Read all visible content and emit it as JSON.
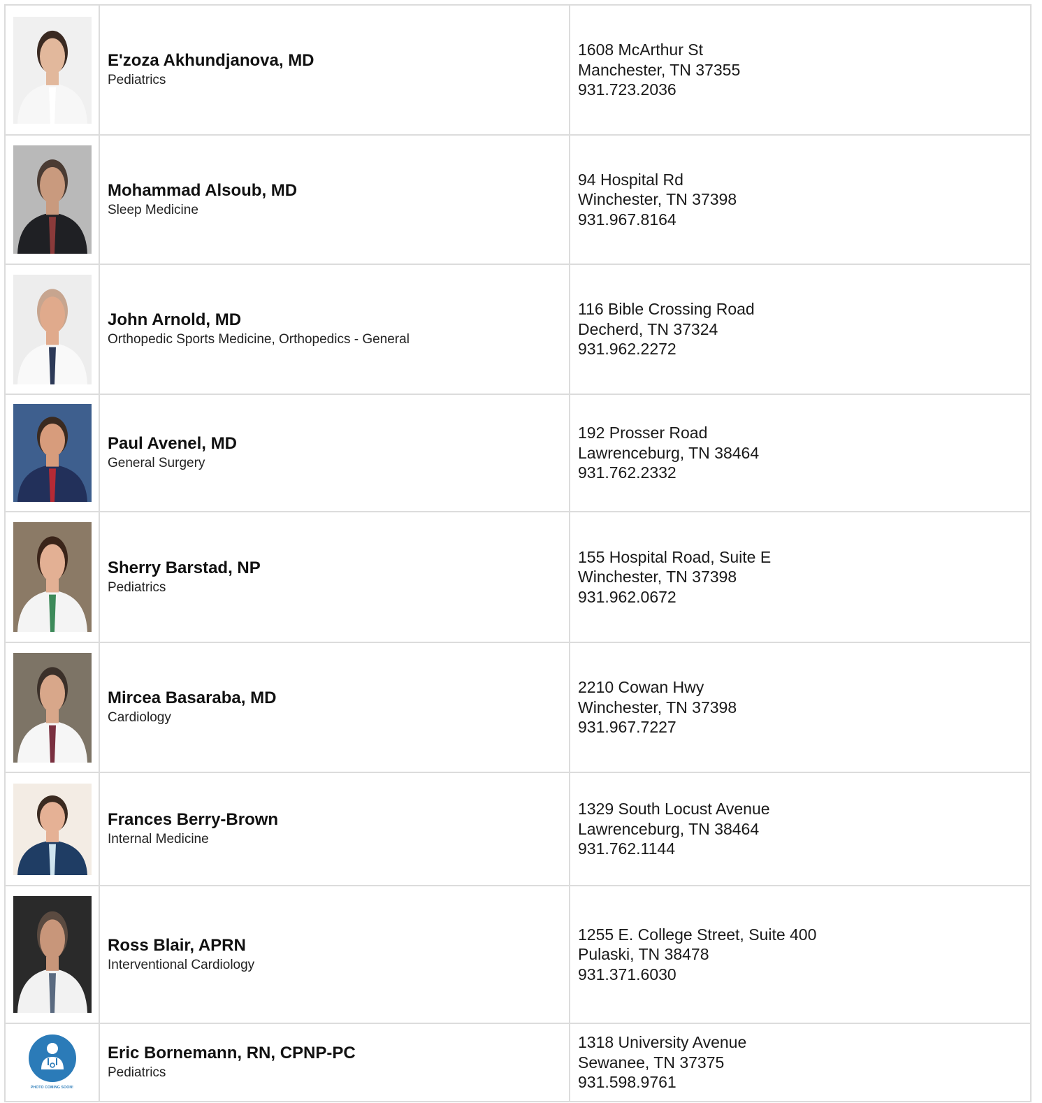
{
  "providers": [
    {
      "name": "E'zoza Akhundjanova, MD",
      "specialty": "Pediatrics",
      "address1": "1608 McArthur St",
      "address2": "Manchester, TN 37355",
      "phone": "931.723.2036",
      "photo": {
        "bg": "#f0f0f0",
        "skin": "#e2b89c",
        "hair": "#3a2a22",
        "coat": "#f7f7f7",
        "accent": "#ffffff"
      }
    },
    {
      "name": "Mohammad Alsoub, MD",
      "specialty": "Sleep Medicine",
      "address1": "94 Hospital Rd",
      "address2": "Winchester, TN 37398",
      "phone": "931.967.8164",
      "photo": {
        "bg": "#b9b9b9",
        "skin": "#c99a7e",
        "hair": "#4a3b33",
        "coat": "#1f2024",
        "accent": "#8a3a3a"
      }
    },
    {
      "name": "John Arnold, MD",
      "specialty": "Orthopedic Sports Medicine, Orthopedics - General",
      "address1": "116 Bible Crossing Road",
      "address2": "Decherd, TN 37324",
      "phone": "931.962.2272",
      "photo": {
        "bg": "#ededed",
        "skin": "#e0aa8c",
        "hair": "#c7a58f",
        "coat": "#f9f9f9",
        "accent": "#2d3a58"
      }
    },
    {
      "name": "Paul Avenel, MD",
      "specialty": "General Surgery",
      "address1": "192 Prosser Road",
      "address2": "Lawrenceburg, TN 38464",
      "phone": "931.762.2332",
      "photo": {
        "bg": "#3e5f8e",
        "skin": "#d79c7c",
        "hair": "#3a2a20",
        "coat": "#22305a",
        "accent": "#b52a35"
      }
    },
    {
      "name": "Sherry Barstad, NP",
      "specialty": "Pediatrics",
      "address1": "155 Hospital Road, Suite E",
      "address2": "Winchester, TN 37398",
      "phone": "931.962.0672",
      "photo": {
        "bg": "#8b7a66",
        "skin": "#e3b094",
        "hair": "#3a2419",
        "coat": "#f4f4f4",
        "accent": "#3d8a5a"
      }
    },
    {
      "name": "Mircea Basaraba, MD",
      "specialty": "Cardiology",
      "address1": "2210 Cowan Hwy",
      "address2": "Winchester, TN 37398",
      "phone": "931.967.7227",
      "photo": {
        "bg": "#7d7466",
        "skin": "#d8a78a",
        "hair": "#3b3029",
        "coat": "#f6f6f6",
        "accent": "#7a3040"
      }
    },
    {
      "name": "Frances Berry-Brown",
      "specialty": "Internal Medicine",
      "address1": "1329 South Locust Avenue",
      "address2": "Lawrenceburg, TN 38464",
      "phone": "931.762.1144",
      "photo": {
        "bg": "#f3ece4",
        "skin": "#e5b195",
        "hair": "#3a2a20",
        "coat": "#1f3d64",
        "accent": "#cfe4ef"
      }
    },
    {
      "name": "Ross Blair, APRN",
      "specialty": "Interventional Cardiology",
      "address1": "1255 E. College Street, Suite 400",
      "address2": "Pulaski, TN 38478",
      "phone": "931.371.6030",
      "photo": {
        "bg": "#2a2a2a",
        "skin": "#c8967a",
        "hair": "#5a4a40",
        "coat": "#f2f2f2",
        "accent": "#5a6a80"
      }
    },
    {
      "name": "Eric Bornemann, RN, CPNP-PC",
      "specialty": "Pediatrics",
      "address1": "1318 University Avenue",
      "address2": "Sewanee, TN 37375",
      "phone": "931.598.9761",
      "photo": {
        "bg": "#ffffff",
        "skin": "#ffffff",
        "hair": "#ffffff",
        "coat": "#ffffff",
        "accent": "#2b7bb8"
      },
      "photo_caption": "PHOTO COMING SOON!"
    }
  ]
}
